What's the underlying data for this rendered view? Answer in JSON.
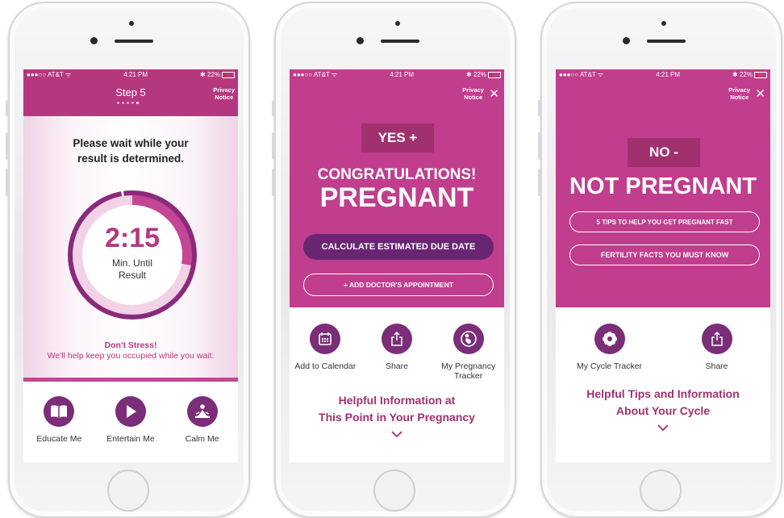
{
  "status": {
    "carrier": "●●●○○ AT&T ᯤ",
    "time": "4:21 PM",
    "battery": "✱ 22%"
  },
  "screen1": {
    "title": "Step 5",
    "privacy": [
      "Privacy",
      "Notice"
    ],
    "message": [
      "Please wait while your",
      "result is determined."
    ],
    "timer": "2:15",
    "timer_label": [
      "Min. Until",
      "Result"
    ],
    "stress_title": "Don't Stress!",
    "stress_text": "We'll help keep you occupied while you wait:",
    "actions": [
      {
        "label": "Educate Me",
        "icon": "book-icon"
      },
      {
        "label": "Entertain Me",
        "icon": "play-icon"
      },
      {
        "label": "Calm Me",
        "icon": "meditation-icon"
      }
    ]
  },
  "screen2": {
    "privacy": [
      "Privacy",
      "Notice"
    ],
    "close": "✕",
    "badge": "YES +",
    "congrats": "CONGRATULATIONS!",
    "result": "PREGNANT",
    "primary_button": "CALCULATE ESTIMATED DUE DATE",
    "secondary_button": "+ ADD DOCTOR'S APPOINTMENT",
    "actions": [
      {
        "label": "Add to Calendar",
        "icon": "calendar-icon"
      },
      {
        "label": "Share",
        "icon": "share-icon"
      },
      {
        "label": "My Pregnancy Tracker",
        "icon": "pregnancy-icon"
      }
    ],
    "info": [
      "Helpful Information at",
      "This Point in Your Pregnancy"
    ],
    "chevron": "⌄"
  },
  "screen3": {
    "privacy": [
      "Privacy",
      "Notice"
    ],
    "close": "✕",
    "badge": "NO -",
    "result": "NOT PREGNANT",
    "button1": "5 TIPS TO HELP YOU GET PREGNANT FAST",
    "button2": "FERTILITY FACTS YOU MUST KNOW",
    "actions": [
      {
        "label": "My Cycle Tracker",
        "icon": "flower-icon"
      },
      {
        "label": "Share",
        "icon": "share-icon"
      }
    ],
    "info": [
      "Helpful Tips and Information",
      "About Your Cycle"
    ],
    "chevron": "⌄"
  },
  "colors": {
    "magenta": "#c03e8d",
    "header": "#b5387f",
    "purple": "#7b2d78",
    "dark_purple": "#6a2572",
    "badge": "#a1306f"
  }
}
